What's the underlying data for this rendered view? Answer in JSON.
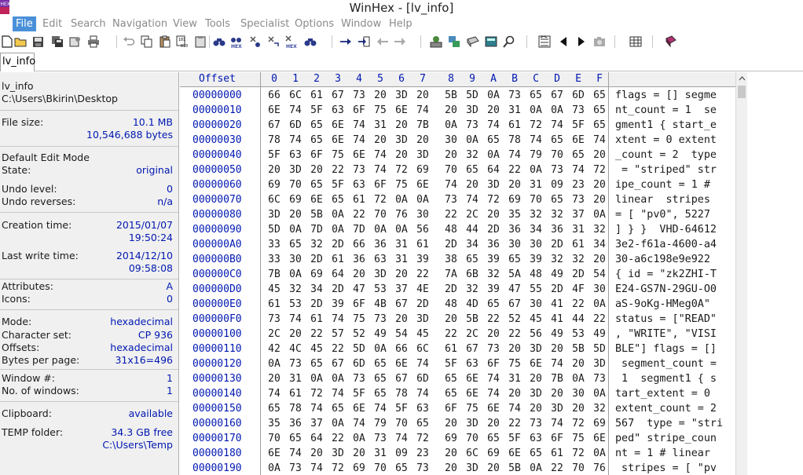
{
  "window": {
    "title": "WinHex - [lv_info]"
  },
  "menu": {
    "items": [
      "File",
      "Edit",
      "Search",
      "Navigation",
      "View",
      "Tools",
      "Specialist",
      "Options",
      "Window",
      "Help"
    ],
    "active": "File"
  },
  "tabs": [
    {
      "label": "lv_info",
      "active": true
    }
  ],
  "info": {
    "filename": "lv_info",
    "path": "C:\\Users\\Bkirin\\Desktop",
    "file_size_label": "File size:",
    "file_size_mb": "10.1 MB",
    "file_size_bytes": "10,546,688 bytes",
    "edit_mode_label": "Default Edit Mode",
    "state_label": "State:",
    "state_value": "original",
    "undo_level_label": "Undo level:",
    "undo_level_value": "0",
    "undo_reverses_label": "Undo reverses:",
    "undo_reverses_value": "n/a",
    "creation_time_label": "Creation time:",
    "creation_date": "2015/01/07",
    "creation_clock": "19:50:24",
    "last_write_label": "Last write time:",
    "last_write_date": "2014/12/10",
    "last_write_clock": "09:58:08",
    "attributes_label": "Attributes:",
    "attributes_value": "A",
    "icons_label": "Icons:",
    "icons_value": "0",
    "mode_label": "Mode:",
    "mode_value": "hexadecimal",
    "charset_label": "Character set:",
    "charset_value": "CP 936",
    "offsets_label": "Offsets:",
    "offsets_value": "hexadecimal",
    "bytes_per_page_label": "Bytes per page:",
    "bytes_per_page_value": "31x16=496",
    "window_num_label": "Window #:",
    "window_num_value": "1",
    "num_windows_label": "No. of windows:",
    "num_windows_value": "1",
    "clipboard_label": "Clipboard:",
    "clipboard_value": "available",
    "temp_label": "TEMP folder:",
    "temp_free": "34.3 GB free",
    "temp_path": "C:\\Users\\Temp"
  },
  "hex": {
    "offset_header": "Offset",
    "column_headers": [
      "0",
      "1",
      "2",
      "3",
      "4",
      "5",
      "6",
      "7",
      "8",
      "9",
      "A",
      "B",
      "C",
      "D",
      "E",
      "F"
    ],
    "rows": [
      {
        "offset": "00000000",
        "bytes": [
          "66",
          "6C",
          "61",
          "67",
          "73",
          "20",
          "3D",
          "20",
          "5B",
          "5D",
          "0A",
          "73",
          "65",
          "67",
          "6D",
          "65"
        ],
        "text": "flags = [] segme"
      },
      {
        "offset": "00000010",
        "bytes": [
          "6E",
          "74",
          "5F",
          "63",
          "6F",
          "75",
          "6E",
          "74",
          "20",
          "3D",
          "20",
          "31",
          "0A",
          "0A",
          "73",
          "65"
        ],
        "text": "nt_count = 1  se"
      },
      {
        "offset": "00000020",
        "bytes": [
          "67",
          "6D",
          "65",
          "6E",
          "74",
          "31",
          "20",
          "7B",
          "0A",
          "73",
          "74",
          "61",
          "72",
          "74",
          "5F",
          "65"
        ],
        "text": "gment1 { start_e"
      },
      {
        "offset": "00000030",
        "bytes": [
          "78",
          "74",
          "65",
          "6E",
          "74",
          "20",
          "3D",
          "20",
          "30",
          "0A",
          "65",
          "78",
          "74",
          "65",
          "6E",
          "74"
        ],
        "text": "xtent = 0 extent"
      },
      {
        "offset": "00000040",
        "bytes": [
          "5F",
          "63",
          "6F",
          "75",
          "6E",
          "74",
          "20",
          "3D",
          "20",
          "32",
          "0A",
          "74",
          "79",
          "70",
          "65",
          "20"
        ],
        "text": "_count = 2  type"
      },
      {
        "offset": "00000050",
        "bytes": [
          "20",
          "3D",
          "20",
          "22",
          "73",
          "74",
          "72",
          "69",
          "70",
          "65",
          "64",
          "22",
          "0A",
          "73",
          "74",
          "72"
        ],
        "text": " = \"striped\" str"
      },
      {
        "offset": "00000060",
        "bytes": [
          "69",
          "70",
          "65",
          "5F",
          "63",
          "6F",
          "75",
          "6E",
          "74",
          "20",
          "3D",
          "20",
          "31",
          "09",
          "23",
          "20"
        ],
        "text": "ipe_count = 1 # "
      },
      {
        "offset": "00000070",
        "bytes": [
          "6C",
          "69",
          "6E",
          "65",
          "61",
          "72",
          "0A",
          "0A",
          "73",
          "74",
          "72",
          "69",
          "70",
          "65",
          "73",
          "20"
        ],
        "text": "linear  stripes "
      },
      {
        "offset": "00000080",
        "bytes": [
          "3D",
          "20",
          "5B",
          "0A",
          "22",
          "70",
          "76",
          "30",
          "22",
          "2C",
          "20",
          "35",
          "32",
          "32",
          "37",
          "0A"
        ],
        "text": "= [ \"pv0\", 5227 "
      },
      {
        "offset": "00000090",
        "bytes": [
          "5D",
          "0A",
          "7D",
          "0A",
          "7D",
          "0A",
          "0A",
          "56",
          "48",
          "44",
          "2D",
          "36",
          "34",
          "36",
          "31",
          "32"
        ],
        "text": "] } }  VHD-64612"
      },
      {
        "offset": "000000A0",
        "bytes": [
          "33",
          "65",
          "32",
          "2D",
          "66",
          "36",
          "31",
          "61",
          "2D",
          "34",
          "36",
          "30",
          "30",
          "2D",
          "61",
          "34"
        ],
        "text": "3e2-f61a-4600-a4"
      },
      {
        "offset": "000000B0",
        "bytes": [
          "33",
          "30",
          "2D",
          "61",
          "36",
          "63",
          "31",
          "39",
          "38",
          "65",
          "39",
          "65",
          "39",
          "32",
          "32",
          "20"
        ],
        "text": "30-a6c198e9e922 "
      },
      {
        "offset": "000000C0",
        "bytes": [
          "7B",
          "0A",
          "69",
          "64",
          "20",
          "3D",
          "20",
          "22",
          "7A",
          "6B",
          "32",
          "5A",
          "48",
          "49",
          "2D",
          "54"
        ],
        "text": "{ id = \"zk2ZHI-T"
      },
      {
        "offset": "000000D0",
        "bytes": [
          "45",
          "32",
          "34",
          "2D",
          "47",
          "53",
          "37",
          "4E",
          "2D",
          "32",
          "39",
          "47",
          "55",
          "2D",
          "4F",
          "30"
        ],
        "text": "E24-GS7N-29GU-O0"
      },
      {
        "offset": "000000E0",
        "bytes": [
          "61",
          "53",
          "2D",
          "39",
          "6F",
          "4B",
          "67",
          "2D",
          "48",
          "4D",
          "65",
          "67",
          "30",
          "41",
          "22",
          "0A"
        ],
        "text": "aS-9oKg-HMeg0A\" "
      },
      {
        "offset": "000000F0",
        "bytes": [
          "73",
          "74",
          "61",
          "74",
          "75",
          "73",
          "20",
          "3D",
          "20",
          "5B",
          "22",
          "52",
          "45",
          "41",
          "44",
          "22"
        ],
        "text": "status = [\"READ\""
      },
      {
        "offset": "00000100",
        "bytes": [
          "2C",
          "20",
          "22",
          "57",
          "52",
          "49",
          "54",
          "45",
          "22",
          "2C",
          "20",
          "22",
          "56",
          "49",
          "53",
          "49"
        ],
        "text": ", \"WRITE\", \"VISI"
      },
      {
        "offset": "00000110",
        "bytes": [
          "42",
          "4C",
          "45",
          "22",
          "5D",
          "0A",
          "66",
          "6C",
          "61",
          "67",
          "73",
          "20",
          "3D",
          "20",
          "5B",
          "5D"
        ],
        "text": "BLE\"] flags = []"
      },
      {
        "offset": "00000120",
        "bytes": [
          "0A",
          "73",
          "65",
          "67",
          "6D",
          "65",
          "6E",
          "74",
          "5F",
          "63",
          "6F",
          "75",
          "6E",
          "74",
          "20",
          "3D"
        ],
        "text": " segment_count ="
      },
      {
        "offset": "00000130",
        "bytes": [
          "20",
          "31",
          "0A",
          "0A",
          "73",
          "65",
          "67",
          "6D",
          "65",
          "6E",
          "74",
          "31",
          "20",
          "7B",
          "0A",
          "73"
        ],
        "text": " 1  segment1 { s"
      },
      {
        "offset": "00000140",
        "bytes": [
          "74",
          "61",
          "72",
          "74",
          "5F",
          "65",
          "78",
          "74",
          "65",
          "6E",
          "74",
          "20",
          "3D",
          "20",
          "30",
          "0A"
        ],
        "text": "tart_extent = 0 "
      },
      {
        "offset": "00000150",
        "bytes": [
          "65",
          "78",
          "74",
          "65",
          "6E",
          "74",
          "5F",
          "63",
          "6F",
          "75",
          "6E",
          "74",
          "20",
          "3D",
          "20",
          "32"
        ],
        "text": "extent_count = 2"
      },
      {
        "offset": "00000160",
        "bytes": [
          "35",
          "36",
          "37",
          "0A",
          "74",
          "79",
          "70",
          "65",
          "20",
          "3D",
          "20",
          "22",
          "73",
          "74",
          "72",
          "69"
        ],
        "text": "567  type = \"stri"
      },
      {
        "offset": "00000170",
        "bytes": [
          "70",
          "65",
          "64",
          "22",
          "0A",
          "73",
          "74",
          "72",
          "69",
          "70",
          "65",
          "5F",
          "63",
          "6F",
          "75",
          "6E"
        ],
        "text": "ped\" stripe_coun"
      },
      {
        "offset": "00000180",
        "bytes": [
          "6E",
          "74",
          "20",
          "3D",
          "20",
          "31",
          "09",
          "23",
          "20",
          "6C",
          "69",
          "6E",
          "65",
          "61",
          "72",
          "0A"
        ],
        "text": "nt = 1 # linear "
      },
      {
        "offset": "00000190",
        "bytes": [
          "0A",
          "73",
          "74",
          "72",
          "69",
          "70",
          "65",
          "73",
          "20",
          "3D",
          "20",
          "5B",
          "0A",
          "22",
          "70",
          "76"
        ],
        "text": " stripes = [ \"pv"
      }
    ]
  },
  "colors": {
    "accent": "#4a90d9",
    "offset_blue": "#0018b0",
    "panel_bg": "#f0f0f0"
  },
  "toolbar_icons": [
    "new-file-icon",
    "open-icon",
    "save-icon",
    "save-all-icon",
    "properties-icon",
    "print-icon",
    "undo-icon",
    "copy-icon",
    "paste-icon",
    "write-hex-icon",
    "find-icon",
    "find-hex-icon",
    "replace-icon",
    "replace-hex-icon",
    "goto-icon",
    "goto-offset-icon",
    "back-icon",
    "forward-icon",
    "disk-icon",
    "ram-icon",
    "edit-disk-icon",
    "calculator-icon",
    "magnifier-icon",
    "template-icon",
    "prev-icon",
    "next-icon",
    "camera-icon",
    "table-icon",
    "book-icon"
  ]
}
